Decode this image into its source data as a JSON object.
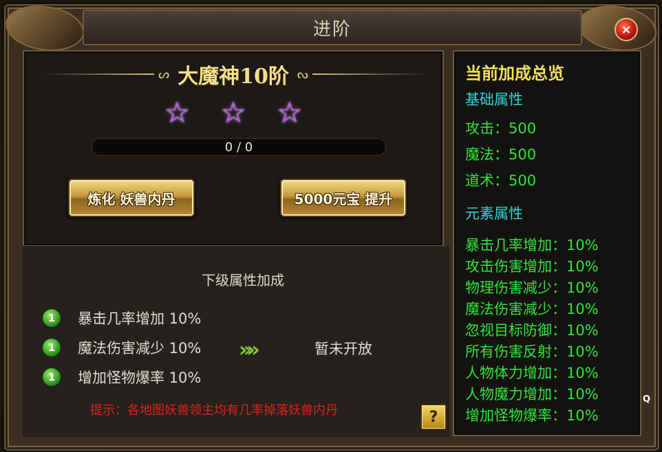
{
  "window": {
    "title": "进阶",
    "close_icon": "×"
  },
  "stage": {
    "name": "大魔神10阶",
    "ornament_left": "ᔕ",
    "ornament_right": "ᔓ",
    "stars": [
      "☆",
      "☆",
      "☆"
    ],
    "star_color": "#b048d8",
    "progress_text": "0 / 0",
    "progress_fraction": 0
  },
  "buttons": {
    "refine_label": "炼化 妖兽内丹",
    "upgrade_label": "5000元宝 提升",
    "help_label": "?"
  },
  "next_level": {
    "title": "下级属性加成",
    "attributes": [
      {
        "index": "1",
        "text": "暴击几率增加 10%"
      },
      {
        "index": "1",
        "text": "魔法伤害减少 10%"
      },
      {
        "index": "1",
        "text": "增加怪物爆率 10%"
      }
    ],
    "arrows": "»",
    "status": "暂未开放",
    "hint": "提示：各地图妖兽领主均有几率掉落妖兽内丹"
  },
  "summary": {
    "title": "当前加成总览",
    "base_section": "基础属性",
    "base_stats": [
      "攻击：500",
      "魔法：500",
      "道术：500"
    ],
    "element_section": "元素属性",
    "element_stats": [
      "暴击几率增加：10%",
      "攻击伤害增加：10%",
      "物理伤害减少：10%",
      "魔法伤害减少：10%",
      "忽视目标防御：10%",
      "所有伤害反射：10%",
      "人物体力增加：10%",
      "人物魔力增加：10%",
      "增加怪物爆率：10%"
    ]
  },
  "misc": {
    "corner_glyph": "Q"
  },
  "colors": {
    "title_yellow": "#f2e25a",
    "section_cyan": "#38d2d8",
    "stat_green": "#2ee63a",
    "hint_red": "#e0231a"
  }
}
